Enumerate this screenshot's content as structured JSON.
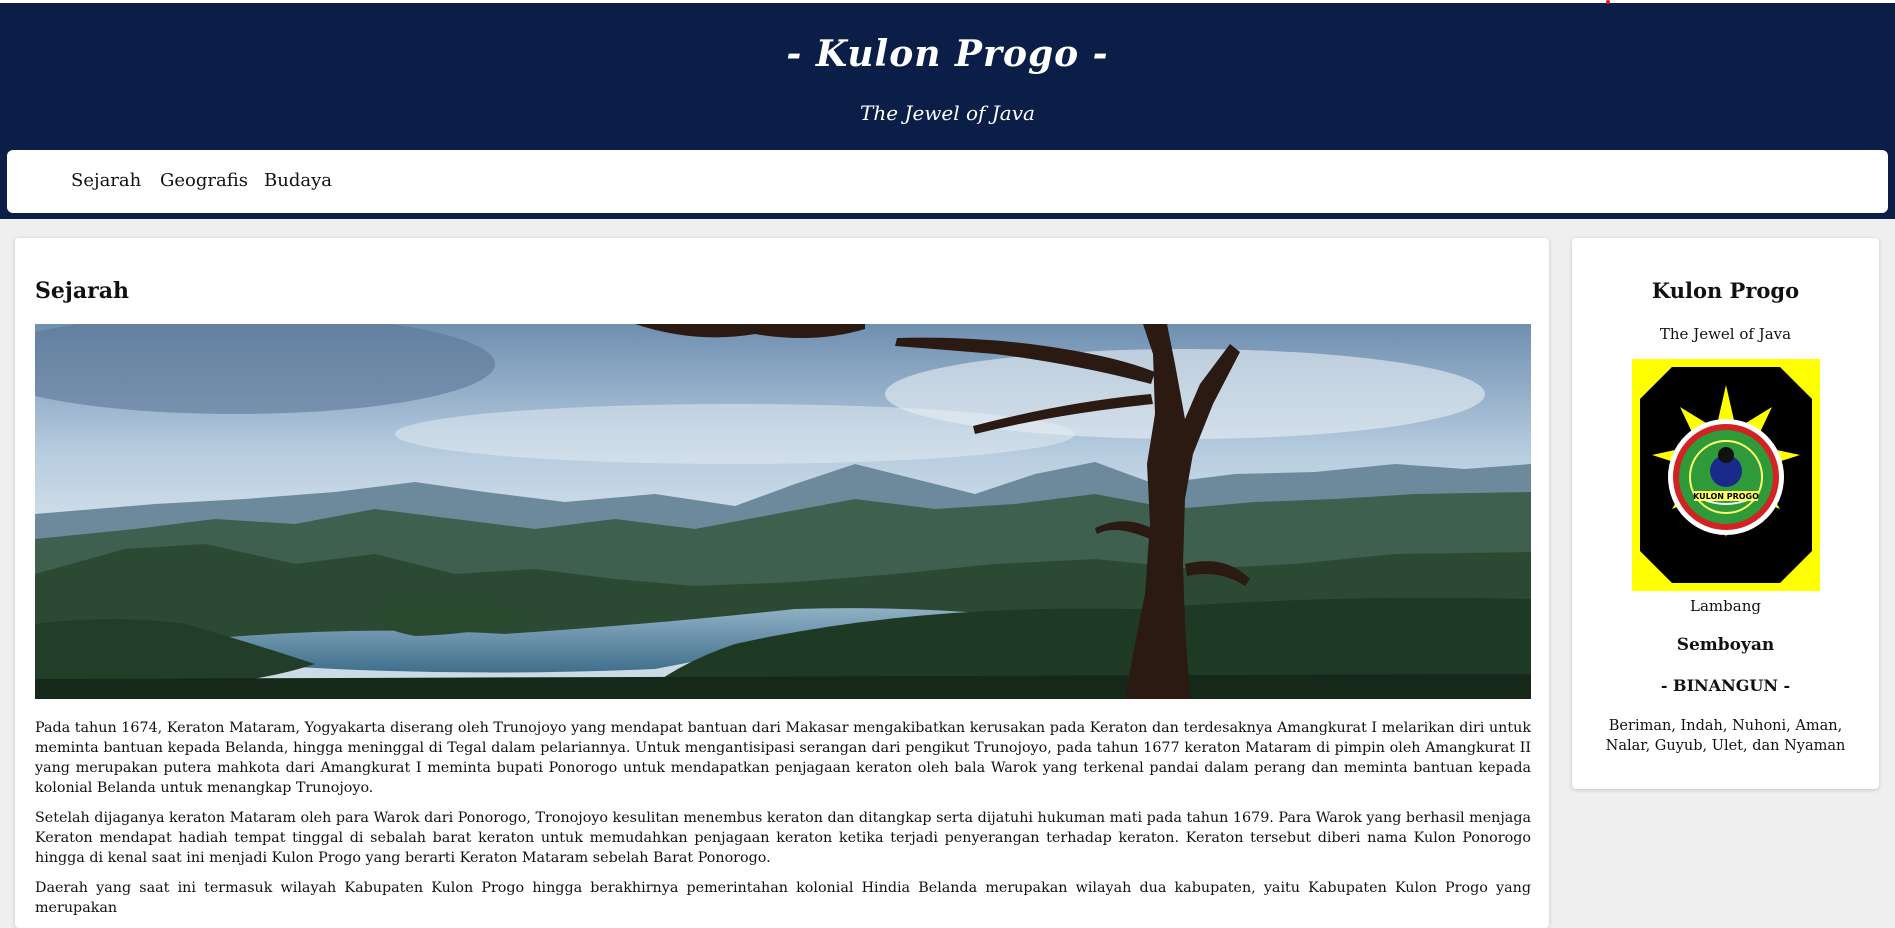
{
  "header": {
    "title": "- Kulon Progo -",
    "tagline": "The Jewel of Java"
  },
  "nav": {
    "items": [
      "Sejarah",
      "Geografis",
      "Budaya"
    ]
  },
  "main": {
    "title": "Sejarah",
    "paragraphs": [
      "Pada tahun 1674, Keraton Mataram, Yogyakarta diserang oleh Trunojoyo yang mendapat bantuan dari Makasar mengakibatkan kerusakan pada Keraton dan terdesaknya Amangkurat I melarikan diri untuk meminta bantuan kepada Belanda, hingga meninggal di Tegal dalam pelariannya. Untuk mengantisipasi serangan dari pengikut Trunojoyo, pada tahun 1677 keraton Mataram di pimpin oleh Amangkurat II yang merupakan putera mahkota dari Amangkurat I meminta bupati Ponorogo untuk mendapatkan penjagaan keraton oleh bala Warok yang terkenal pandai dalam perang dan meminta bantuan kepada kolonial Belanda untuk menangkap Trunojoyo.",
      "Setelah dijaganya keraton Mataram oleh para Warok dari Ponorogo, Tronojoyo kesulitan menembus keraton dan ditangkap serta dijatuhi hukuman mati pada tahun 1679. Para Warok yang berhasil menjaga Keraton mendapat hadiah tempat tinggal di sebalah barat keraton untuk memudahkan penjagaan keraton ketika terjadi penyerangan terhadap keraton. Keraton tersebut diberi nama Kulon Ponorogo hingga di kenal saat ini menjadi Kulon Progo yang berarti Keraton Mataram sebelah Barat Ponorogo.",
      "Daerah yang saat ini termasuk wilayah Kabupaten Kulon Progo hingga berakhirnya pemerintahan kolonial Hindia Belanda merupakan wilayah dua kabupaten, yaitu Kabupaten Kulon Progo yang merupakan"
    ]
  },
  "sidebar": {
    "title": "Kulon Progo",
    "tagline": "The Jewel of Java",
    "emblem_text": "KULON PROGO",
    "emblem_caption": "Lambang",
    "motto_heading": "Semboyan",
    "motto": "- BINANGUN -",
    "motto_meaning": "Beriman, Indah, Nuhoni, Aman, Nalar, Guyub, Ulet, dan Nyaman"
  },
  "colors": {
    "header_bg": "#0b1e47",
    "page_bg": "#efefef",
    "card_bg": "#ffffff"
  }
}
